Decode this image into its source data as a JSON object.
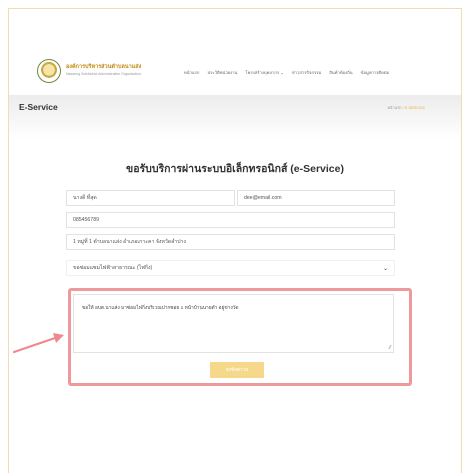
{
  "header": {
    "logo_title": "องค์การบริหารส่วนตำบลนาแส่ง",
    "logo_subtitle": "Nasaeng Subdistrict Administrative Organization",
    "nav": [
      "หน้าแรก",
      "ประวัติหน่วยงาน",
      "โครงสร้างบุคลากร ⌄",
      "ข่าวสารกิจกรรม",
      "สินค้าท้องถิ่น",
      "ข้อมูลการติดต่อ"
    ]
  },
  "band": {
    "title": "E-Service",
    "crumb_home": "หน้าแรก",
    "crumb_sep": " / ",
    "crumb_current": "E-SERVICE"
  },
  "form": {
    "heading": "ขอรับบริการผ่านระบบอิเล็กทรอนิกส์ (e-Service)",
    "name": "นางดี ที่สุด",
    "email": "dee@email.com",
    "phone": "085456789",
    "address": "1 หมู่ที่ 1 ตำบลนาแส่ง อำเภอเกาะคา จังหวัดลำปาง",
    "service_type": "ขอซ่อมแซมไฟฟ้าสาธารณะ (ไฟกิ่ง)",
    "message": "ขอให้ อบต.นาแส่ง มาซ่อมไฟกิ่งบริเวณปากซอย 1 หน้าบ้านนายดำ อยู่ข่างวัด",
    "submit_label": "ส่งข้อความ"
  },
  "colors": {
    "accent": "#e4b33b",
    "submit_bg": "#f6d88a",
    "highlight": "#ee9a9c"
  }
}
